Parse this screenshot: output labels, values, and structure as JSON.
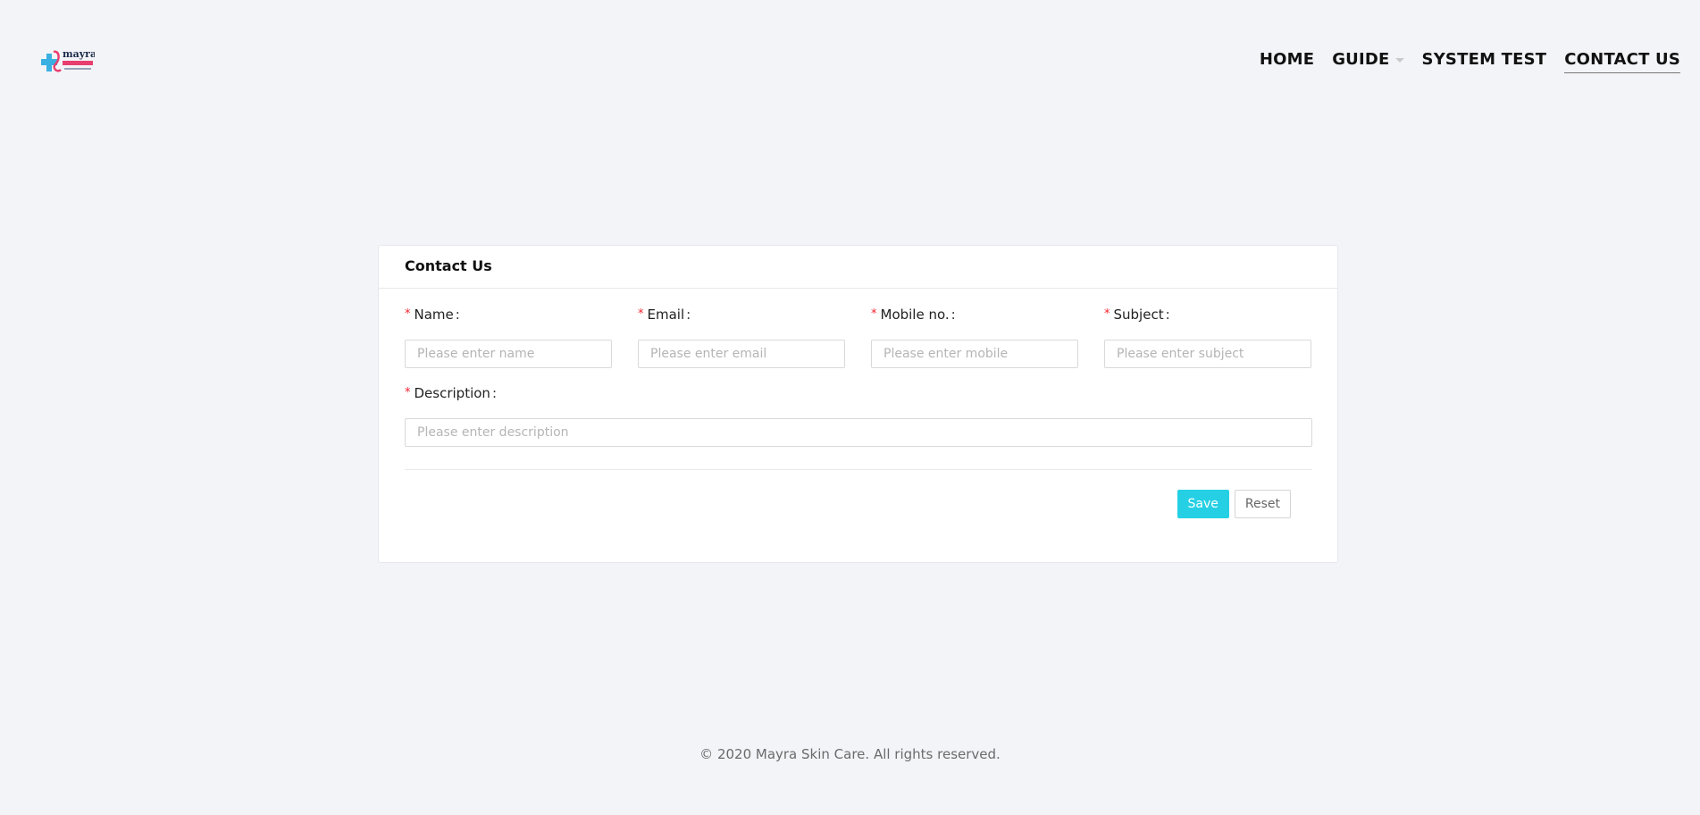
{
  "header": {
    "logo": {
      "name": "mayra",
      "icon": "medical-cross-logo-icon"
    },
    "nav": [
      {
        "label": "HOME"
      },
      {
        "label": "GUIDE",
        "has_dropdown": true
      },
      {
        "label": "SYSTEM TEST"
      },
      {
        "label": "CONTACT US",
        "active": true
      }
    ]
  },
  "form": {
    "title": "Contact Us",
    "required_mark": "*",
    "colon": ":",
    "fields": {
      "name": {
        "label": "Name",
        "placeholder": "Please enter name",
        "value": ""
      },
      "email": {
        "label": "Email",
        "placeholder": "Please enter email",
        "value": ""
      },
      "mobile": {
        "label": "Mobile no.",
        "placeholder": "Please enter mobile",
        "value": ""
      },
      "subject": {
        "label": "Subject",
        "placeholder": "Please enter subject",
        "value": ""
      },
      "description": {
        "label": "Description",
        "placeholder": "Please enter description",
        "value": ""
      }
    },
    "save_label": "Save",
    "reset_label": "Reset"
  },
  "footer": {
    "text": "© 2020 Mayra Skin Care. All rights reserved."
  },
  "colors": {
    "background": "#f3f4f8",
    "accent": "#26d0e4",
    "required": "#f5222d",
    "logo_blue": "#3ab0e2",
    "logo_pink": "#e83e6f"
  }
}
